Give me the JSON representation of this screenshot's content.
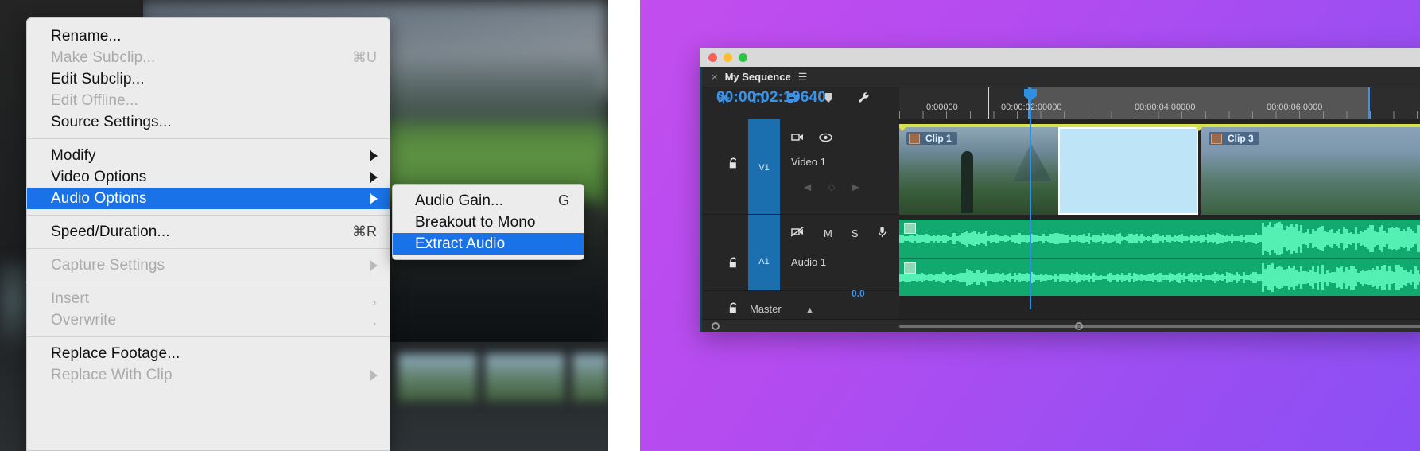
{
  "context_menu": {
    "groups": [
      {
        "items": [
          {
            "label": "Rename...",
            "shortcut": "",
            "state": "enabled",
            "submenu": false
          },
          {
            "label": "Make Subclip...",
            "shortcut": "⌘U",
            "state": "disabled",
            "submenu": false
          },
          {
            "label": "Edit Subclip...",
            "shortcut": "",
            "state": "enabled",
            "submenu": false
          },
          {
            "label": "Edit Offline...",
            "shortcut": "",
            "state": "disabled",
            "submenu": false
          },
          {
            "label": "Source Settings...",
            "shortcut": "",
            "state": "enabled",
            "submenu": false
          }
        ]
      },
      {
        "items": [
          {
            "label": "Modify",
            "shortcut": "",
            "state": "enabled",
            "submenu": true
          },
          {
            "label": "Video Options",
            "shortcut": "",
            "state": "enabled",
            "submenu": true
          },
          {
            "label": "Audio Options",
            "shortcut": "",
            "state": "selected",
            "submenu": true
          }
        ]
      },
      {
        "items": [
          {
            "label": "Speed/Duration...",
            "shortcut": "⌘R",
            "state": "enabled",
            "submenu": false
          }
        ]
      },
      {
        "items": [
          {
            "label": "Capture Settings",
            "shortcut": "",
            "state": "disabled",
            "submenu": true
          }
        ]
      },
      {
        "items": [
          {
            "label": "Insert",
            "shortcut": ",",
            "state": "disabled",
            "submenu": false
          },
          {
            "label": "Overwrite",
            "shortcut": ".",
            "state": "disabled",
            "submenu": false
          }
        ]
      },
      {
        "items": [
          {
            "label": "Replace Footage...",
            "shortcut": "",
            "state": "enabled",
            "submenu": false
          },
          {
            "label": "Replace With Clip",
            "shortcut": "",
            "state": "disabled",
            "submenu": true
          }
        ]
      }
    ]
  },
  "submenu": {
    "items": [
      {
        "label": "Audio Gain...",
        "shortcut": "G",
        "state": "enabled"
      },
      {
        "label": "Breakout to Mono",
        "shortcut": "",
        "state": "enabled"
      },
      {
        "label": "Extract Audio",
        "shortcut": "",
        "state": "selected"
      }
    ]
  },
  "premiere": {
    "window_controls": [
      "close",
      "minimize",
      "zoom"
    ],
    "tab": {
      "close_glyph": "×",
      "title": "My Sequence",
      "menu_glyph": "☰"
    },
    "timecode": "00:00:02:19640",
    "tools": [
      "linked-selection-icon",
      "snap-icon",
      "marker-icon",
      "add-marker-icon",
      "wrench-icon"
    ],
    "ruler": {
      "labels": [
        "0:00000",
        "00:00:02:00000",
        "00:00:04:00000",
        "00:00:06:0000"
      ]
    },
    "tracks": [
      {
        "id": "V1",
        "name": "Video 1",
        "lock_glyph": "🔓",
        "icons": [
          "target-output-icon",
          "eye-icon"
        ],
        "keyframe_nav": [
          "◀",
          "◇",
          "▶"
        ]
      },
      {
        "id": "A1",
        "name": "Audio 1",
        "lock_glyph": "🔓",
        "icons": [
          "mute-speaker-icon",
          "M",
          "S",
          "microphone-icon"
        ],
        "value": "0.0",
        "keyframe_glyph": "⋈"
      }
    ],
    "master": {
      "lock_glyph": "🔓",
      "label": "Master",
      "caret_glyph": "▲"
    },
    "clips": [
      {
        "label": "Clip 1",
        "track": "V1"
      },
      {
        "label": "Clip 3",
        "track": "V1"
      }
    ]
  },
  "colors": {
    "menu_highlight": "#1a72e8",
    "menu_bg": "#edecec",
    "timecode_blue": "#3b93e8",
    "track_select_blue": "#1c6fae",
    "audio_green": "#12a96e",
    "clip_outline_yellow": "#d8e24a",
    "selected_clip": "#bde5f7",
    "backdrop_purple": "#b44cf0"
  }
}
